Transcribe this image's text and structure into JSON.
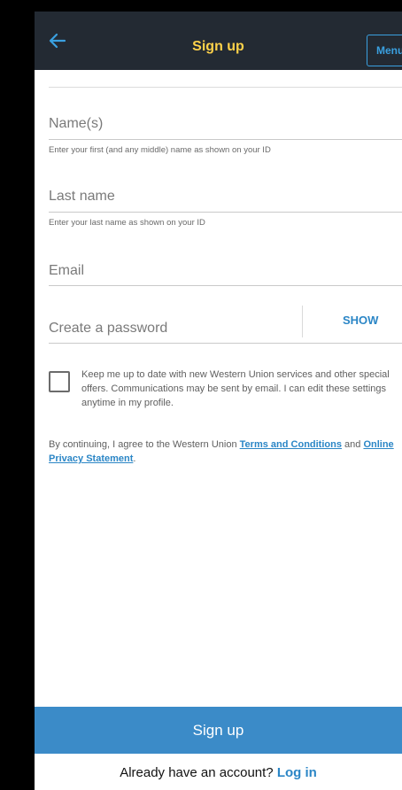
{
  "appbar": {
    "title": "Sign up",
    "menu_label": "Menu",
    "back_icon": "arrow-left-icon",
    "accent": "#ffd24a",
    "link_color": "#3aa0e0"
  },
  "form": {
    "names": {
      "label": "Name(s)",
      "hint": "Enter your first (and any middle) name as shown on your ID"
    },
    "last_name": {
      "label": "Last name",
      "hint": "Enter your last name as shown on your ID"
    },
    "email": {
      "label": "Email"
    },
    "password": {
      "label": "Create a password",
      "show_label": "SHOW"
    }
  },
  "consent": {
    "text": "Keep me up to date with new Western Union services and other special offers. Communications may be sent by email. I can edit these settings anytime in my profile."
  },
  "legal": {
    "prefix": "By continuing, I agree to the Western Union ",
    "terms_link": "Terms and Conditions",
    "middle": " and ",
    "privacy_link": "Online Privacy Statement",
    "suffix": "."
  },
  "footer": {
    "signup_label": "Sign up",
    "login_prompt": "Already have an account? ",
    "login_link": "Log in",
    "button_color": "#3b8bc8"
  }
}
